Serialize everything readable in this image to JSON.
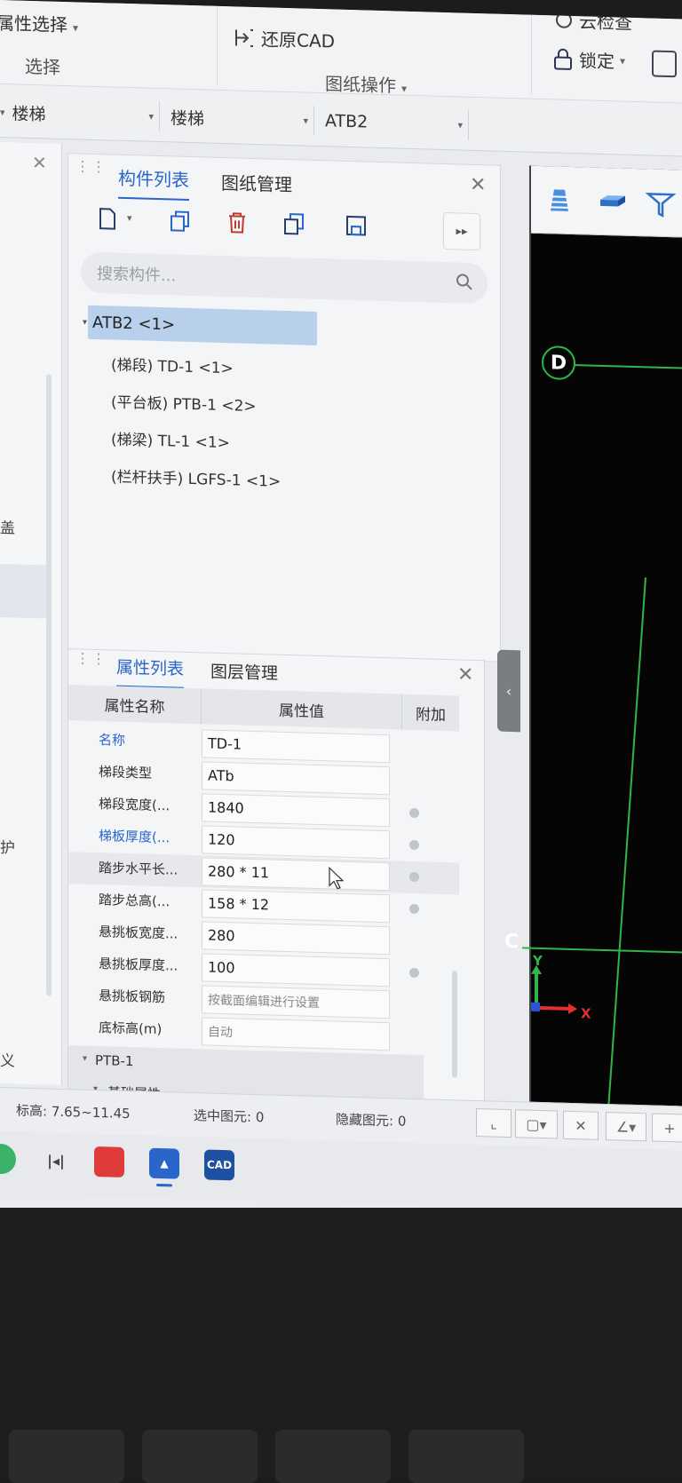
{
  "ribbon": {
    "prop_select": "属性选择",
    "select_label": "选择",
    "restore_cad": "还原CAD",
    "drawing_ops": "图纸操作",
    "cloud_check": "云检查",
    "lock": "锁定"
  },
  "combos": [
    {
      "value": "楼梯"
    },
    {
      "value": "楼梯"
    },
    {
      "value": "ATB2"
    }
  ],
  "left_panel": {
    "text_a": "盖",
    "text_b": "护",
    "text_c": "义"
  },
  "component_panel": {
    "tabs": [
      "构件列表",
      "图纸管理"
    ],
    "search_placeholder": "搜索构件...",
    "tree_root": "ATB2 <1>",
    "tree_items": [
      "(梯段) TD-1 <1>",
      "(平台板) PTB-1 <2>",
      "(梯梁) TL-1 <1>",
      "(栏杆扶手) LGFS-1 <1>"
    ]
  },
  "property_panel": {
    "tabs": [
      "属性列表",
      "图层管理"
    ],
    "columns": [
      "属性名称",
      "属性值",
      "附加"
    ],
    "rows": [
      {
        "name": "名称",
        "value": "TD-1"
      },
      {
        "name": "梯段类型",
        "value": "ATb"
      },
      {
        "name": "梯段宽度(...",
        "value": "1840"
      },
      {
        "name": "梯板厚度(...",
        "value": "120"
      },
      {
        "name": "踏步水平长...",
        "value": "280 * 11"
      },
      {
        "name": "踏步总高(...",
        "value": "158 * 12"
      },
      {
        "name": "悬挑板宽度...",
        "value": "280"
      },
      {
        "name": "悬挑板厚度...",
        "value": "100"
      },
      {
        "name": "悬挑板钢筋",
        "value": "按截面编辑进行设置"
      },
      {
        "name": "底标高(m)",
        "value": "自动"
      }
    ],
    "groups": [
      "PTB-1",
      "基础属性"
    ]
  },
  "viewport": {
    "axis_d": "D",
    "axis_c": "C",
    "ucs_x": "X",
    "ucs_y": "Y",
    "grid_color": "#2fb54a"
  },
  "statusbar": {
    "elevation": "标高:  7.65~11.45",
    "selected": "选中图元: 0",
    "hidden": "隐藏图元: 0"
  },
  "taskbar": {
    "cad_app": "CAD"
  }
}
